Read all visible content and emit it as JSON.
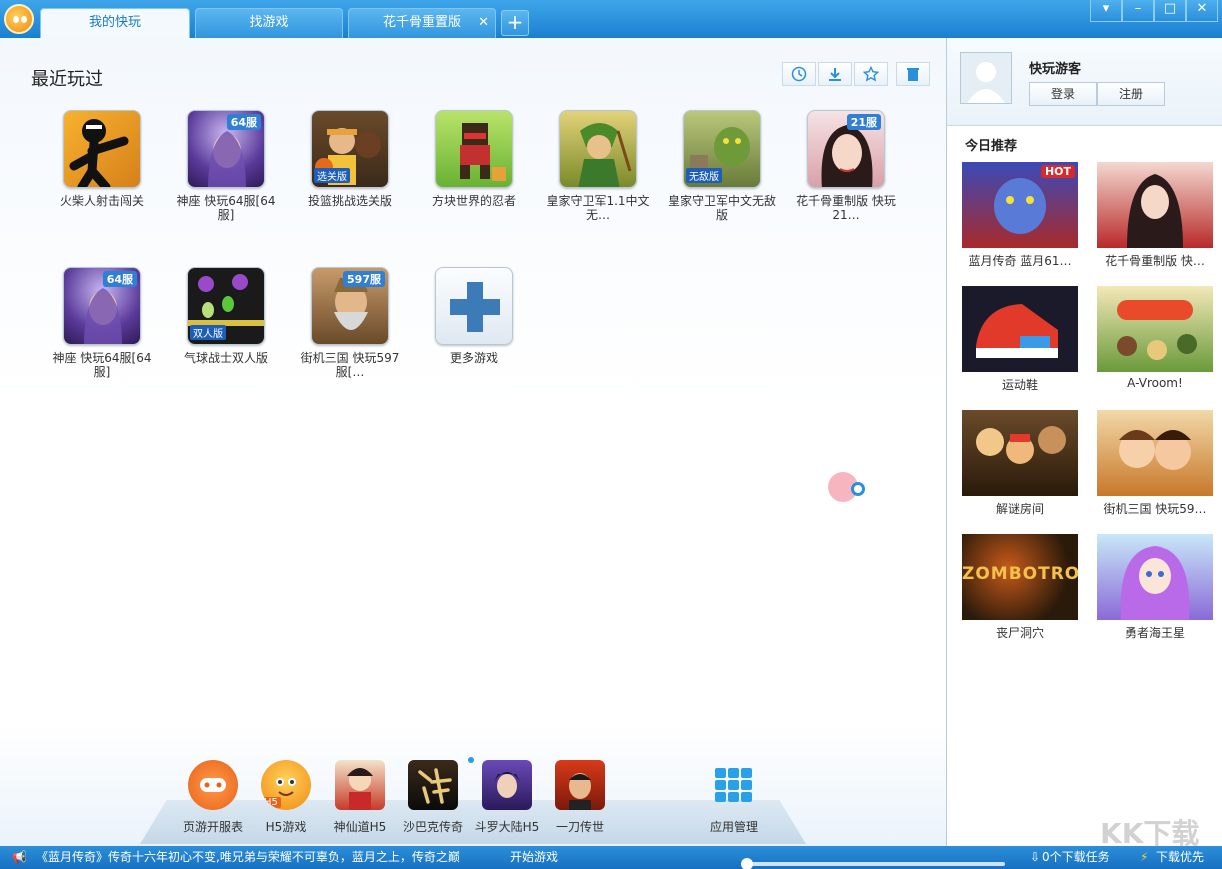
{
  "tabs": [
    {
      "label": "我的快玩",
      "active": true
    },
    {
      "label": "找游戏",
      "active": false
    },
    {
      "label": "花千骨重置版",
      "active": false,
      "closable": true
    }
  ],
  "tab_add": "+",
  "window_controls": [
    "▾",
    "–",
    "□",
    "✕"
  ],
  "main": {
    "section_title": "最近玩过",
    "recent_games": [
      {
        "name": "火柴人射击闯关"
      },
      {
        "name": "神座 快玩64服[64服]",
        "badge": "64服"
      },
      {
        "name": "投篮挑战选关版",
        "badge_bottom": "选关版"
      },
      {
        "name": "方块世界的忍者"
      },
      {
        "name": "皇家守卫军1.1中文无…"
      },
      {
        "name": "皇家守卫军中文无敌版",
        "badge_bottom": "无敌版"
      },
      {
        "name": "花千骨重制版 快玩21…",
        "badge": "21服"
      },
      {
        "name": "神座 快玩64服[64服]",
        "badge": "64服"
      },
      {
        "name": "气球战士双人版",
        "badge_bottom": "双人版"
      },
      {
        "name": "街机三国 快玩597服[…",
        "badge": "597服"
      },
      {
        "name": "更多游戏"
      }
    ]
  },
  "dock": [
    {
      "label": "页游开服表"
    },
    {
      "label": "H5游戏",
      "badge": "H5"
    },
    {
      "label": "神仙道H5"
    },
    {
      "label": "沙巴克传奇"
    },
    {
      "label": "斗罗大陆H5"
    },
    {
      "label": "一刀传世"
    },
    {
      "label": "应用管理"
    }
  ],
  "side": {
    "username": "快玩游客",
    "login": "登录",
    "register": "注册",
    "recommend_title": "今日推荐",
    "recommend": [
      {
        "name": "蓝月传奇  蓝月61…",
        "tag": "HOT"
      },
      {
        "name": "花千骨重制版  快…"
      },
      {
        "name": "运动鞋"
      },
      {
        "name": "A-Vroom!"
      },
      {
        "name": "解谜房间"
      },
      {
        "name": "街机三国  快玩59…"
      },
      {
        "name": "丧尸洞穴",
        "art_text": "ZOMBOTRON"
      },
      {
        "name": "勇者海王星"
      }
    ]
  },
  "status": {
    "news": "《蓝月传奇》传奇十六年初心不变,唯兄弟与荣耀不可辜负，蓝月之上，传奇之巅",
    "start": "开始游戏",
    "downloads": "0个下载任务",
    "priority": "下载优先"
  },
  "watermark": "KK下载"
}
